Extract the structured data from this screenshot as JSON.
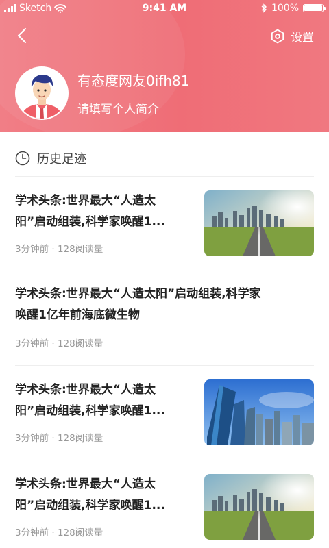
{
  "status_bar": {
    "carrier": "Sketch",
    "time": "9:41 AM",
    "battery": "100%"
  },
  "header": {
    "settings_label": "设置",
    "username": "有态度网友0ifh81",
    "bio_placeholder": "请填写个人简介"
  },
  "history": {
    "title": "历史足迹",
    "items": [
      {
        "title_line1": "学术头条:世界最大“人造太",
        "title_line2": "阳”启动组装,科学家唤醒1...",
        "meta": "3分钟前 · 128阅读量",
        "thumbnail": "road-city-sunset"
      },
      {
        "title_line1": "学术头条:世界最大“人造太阳”启动组装,科学家",
        "title_line2": "唤醒1亿年前海底微生物",
        "meta": "3分钟前 · 128阅读量"
      },
      {
        "title_line1": "学术头条:世界最大“人造太",
        "title_line2": "阳”启动组装,科学家唤醒1...",
        "meta": "3分钟前 · 128阅读量",
        "thumbnail": "skyscrapers-blue-sky"
      },
      {
        "title_line1": "学术头条:世界最大“人造太",
        "title_line2": "阳”启动组装,科学家唤醒1...",
        "meta": "3分钟前 · 128阅读量",
        "thumbnail": "road-city-sunset"
      }
    ]
  },
  "colors": {
    "header_accent": "#ef6d76",
    "text": "#222222",
    "meta": "#999999"
  }
}
